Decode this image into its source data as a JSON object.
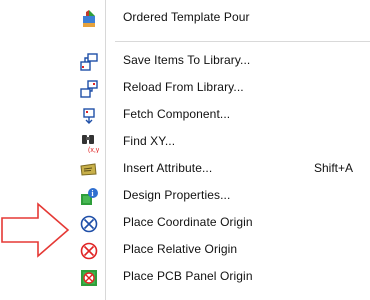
{
  "menu": {
    "items": [
      {
        "id": "ordered-template-pour",
        "label": "Ordered Template Pour",
        "icon": "template-pour-icon"
      },
      {
        "id": "save-items-to-library",
        "label": "Save Items To Library...",
        "icon": "save-to-library-icon"
      },
      {
        "id": "reload-from-library",
        "label": "Reload From Library...",
        "icon": "reload-from-library-icon"
      },
      {
        "id": "fetch-component",
        "label": "Fetch Component...",
        "icon": "fetch-component-icon"
      },
      {
        "id": "find-xy",
        "label": "Find XY...",
        "icon": "find-xy-icon"
      },
      {
        "id": "insert-attribute",
        "label": "Insert Attribute...",
        "shortcut": "Shift+A",
        "icon": "insert-attribute-icon"
      },
      {
        "id": "design-properties",
        "label": "Design Properties...",
        "icon": "design-properties-icon"
      },
      {
        "id": "place-coordinate-origin",
        "label": "Place Coordinate Origin",
        "icon": "coordinate-origin-icon"
      },
      {
        "id": "place-relative-origin",
        "label": "Place Relative Origin",
        "icon": "relative-origin-icon"
      },
      {
        "id": "place-pcb-panel-origin",
        "label": "Place PCB Panel Origin",
        "icon": "pcb-panel-origin-icon"
      }
    ]
  },
  "annotation": {
    "arrow": "red-outline-arrow-icon",
    "arrow_color": "#e53935"
  },
  "colors": {
    "origin_blue": "#1f4fa8",
    "origin_red": "#e02424",
    "panel_green": "#2e9e3a"
  }
}
